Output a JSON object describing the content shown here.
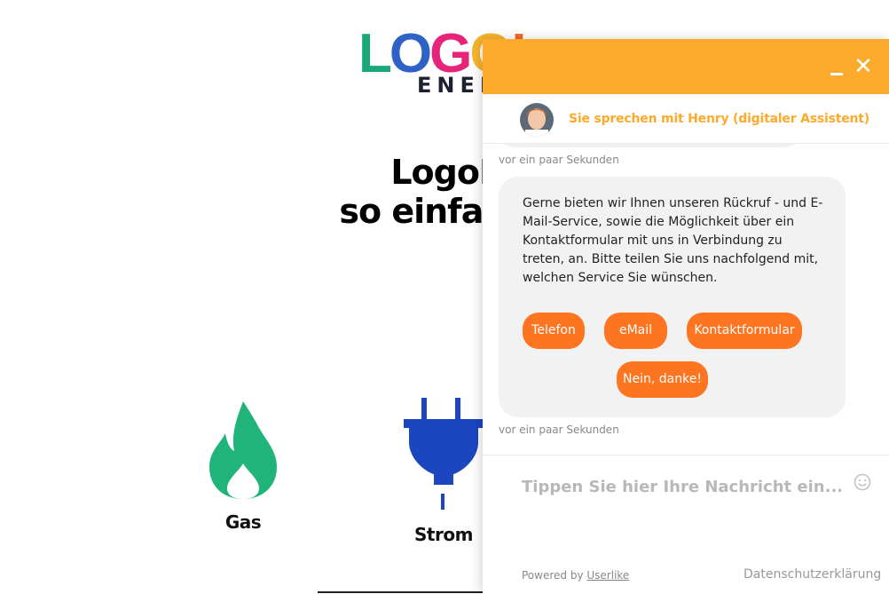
{
  "page": {
    "logo": {
      "word_letters": [
        "L",
        "O",
        "G",
        "O",
        "!"
      ],
      "word_colors": [
        "#1aa87a",
        "#2f62c7",
        "#e6257a",
        "#f7b52c",
        "#f26a2b"
      ],
      "sub": "ENER"
    },
    "headline": {
      "line1": "LogoEnerg",
      "line2": "so einfach war e"
    },
    "products": [
      {
        "label": "Gas",
        "icon": "flame-icon",
        "color": "#20b47a"
      },
      {
        "label": "Strom",
        "icon": "plug-icon",
        "color": "#1c45c0"
      }
    ]
  },
  "chat": {
    "header_color": "#fcaa2b",
    "agent_label": "Sie sprechen mit Henry (digitaler Assistent)",
    "messages": {
      "timestamp_prev": "vor ein paar Sekunden",
      "bubble_text": "Gerne bieten wir Ihnen unseren Rückruf - und E-Mail-Service, sowie die Möglichkeit über ein Kontaktformular mit uns in Verbindung zu treten, an. Bitte teilen Sie uns nachfolgend mit, welchen Service Sie wünschen.",
      "quick_replies": [
        "Telefon",
        "eMail",
        "Kontaktformular",
        "Nein, danke!"
      ],
      "timestamp": "vor ein paar Sekunden"
    },
    "composer": {
      "placeholder": "Tippen Sie hier Ihre Nachricht ein...",
      "powered_prefix": "Powered by",
      "powered_link": "Userlike",
      "privacy": "Datenschutzerklärung"
    },
    "accent_color": "#fd7521"
  }
}
